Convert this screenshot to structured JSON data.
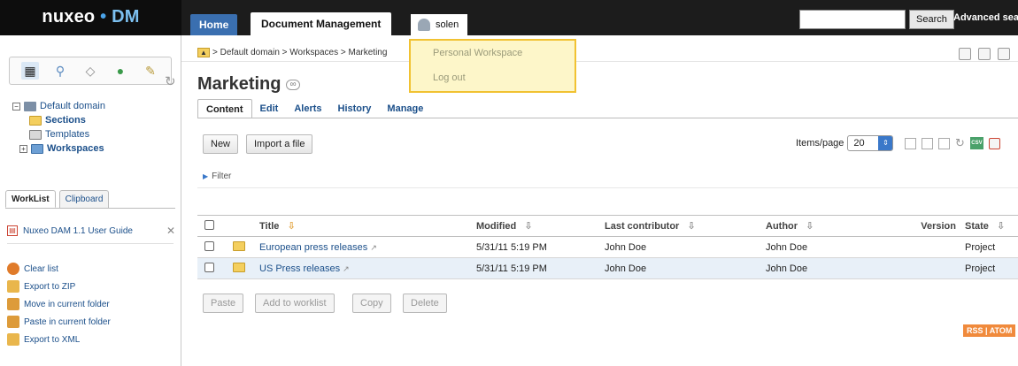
{
  "header": {
    "logo_main": "nuxeo",
    "logo_dot": "•",
    "logo_suffix": "DM",
    "tab_home": "Home",
    "tab_document_management": "Document Management",
    "user_name": "solen",
    "search_placeholder": "",
    "search_button": "Search",
    "advanced_search": "Advanced search"
  },
  "user_menu": {
    "items": [
      "Personal Workspace",
      "Log out"
    ]
  },
  "sidebar": {
    "icon_tabs": [
      "navigation-icon",
      "search-icon",
      "tag-icon",
      "globe-icon",
      "edit-icon"
    ],
    "tree": [
      {
        "label": "Default domain",
        "level": 0
      },
      {
        "label": "Sections",
        "level": 1
      },
      {
        "label": "Templates",
        "level": 1
      },
      {
        "label": "Workspaces",
        "level": 1
      }
    ],
    "worklist_tabs": [
      "WorkList",
      "Clipboard"
    ],
    "worklist_item": "Nuxeo DAM 1.1 User Guide",
    "actions": [
      "Clear list",
      "Export to ZIP",
      "Move in current folder",
      "Paste in current folder",
      "Export to XML"
    ]
  },
  "breadcrumb": {
    "text": "> Default domain > Workspaces > Marketing"
  },
  "page": {
    "title": "Marketing",
    "tabs": [
      "Content",
      "Edit",
      "Alerts",
      "History",
      "Manage"
    ],
    "active_tab": "Content"
  },
  "toolbar": {
    "new_label": "New",
    "import_label": "Import a file",
    "items_per_page_label": "Items/page",
    "items_per_page_value": "20"
  },
  "filter_label": "Filter",
  "table": {
    "columns": [
      "Title",
      "Modified",
      "Last contributor",
      "Author",
      "Version",
      "State"
    ],
    "rows": [
      {
        "title": "European press releases",
        "modified": "5/31/11 5:19 PM",
        "contributor": "John Doe",
        "author": "John Doe",
        "version": "",
        "state": "Project"
      },
      {
        "title": "US Press releases",
        "modified": "5/31/11 5:19 PM",
        "contributor": "John Doe",
        "author": "John Doe",
        "version": "",
        "state": "Project"
      }
    ]
  },
  "bottom_buttons": [
    "Paste",
    "Add to worklist",
    "Copy",
    "Delete"
  ],
  "feed_label": "RSS | ATOM",
  "colors": {
    "header_bg": "#1c1c1c",
    "home_tab": "#3a6fb0",
    "link": "#1b4f8a",
    "row_alt": "#e8f0f8",
    "menu_border": "#f1c232",
    "rss": "#f08a3c"
  }
}
